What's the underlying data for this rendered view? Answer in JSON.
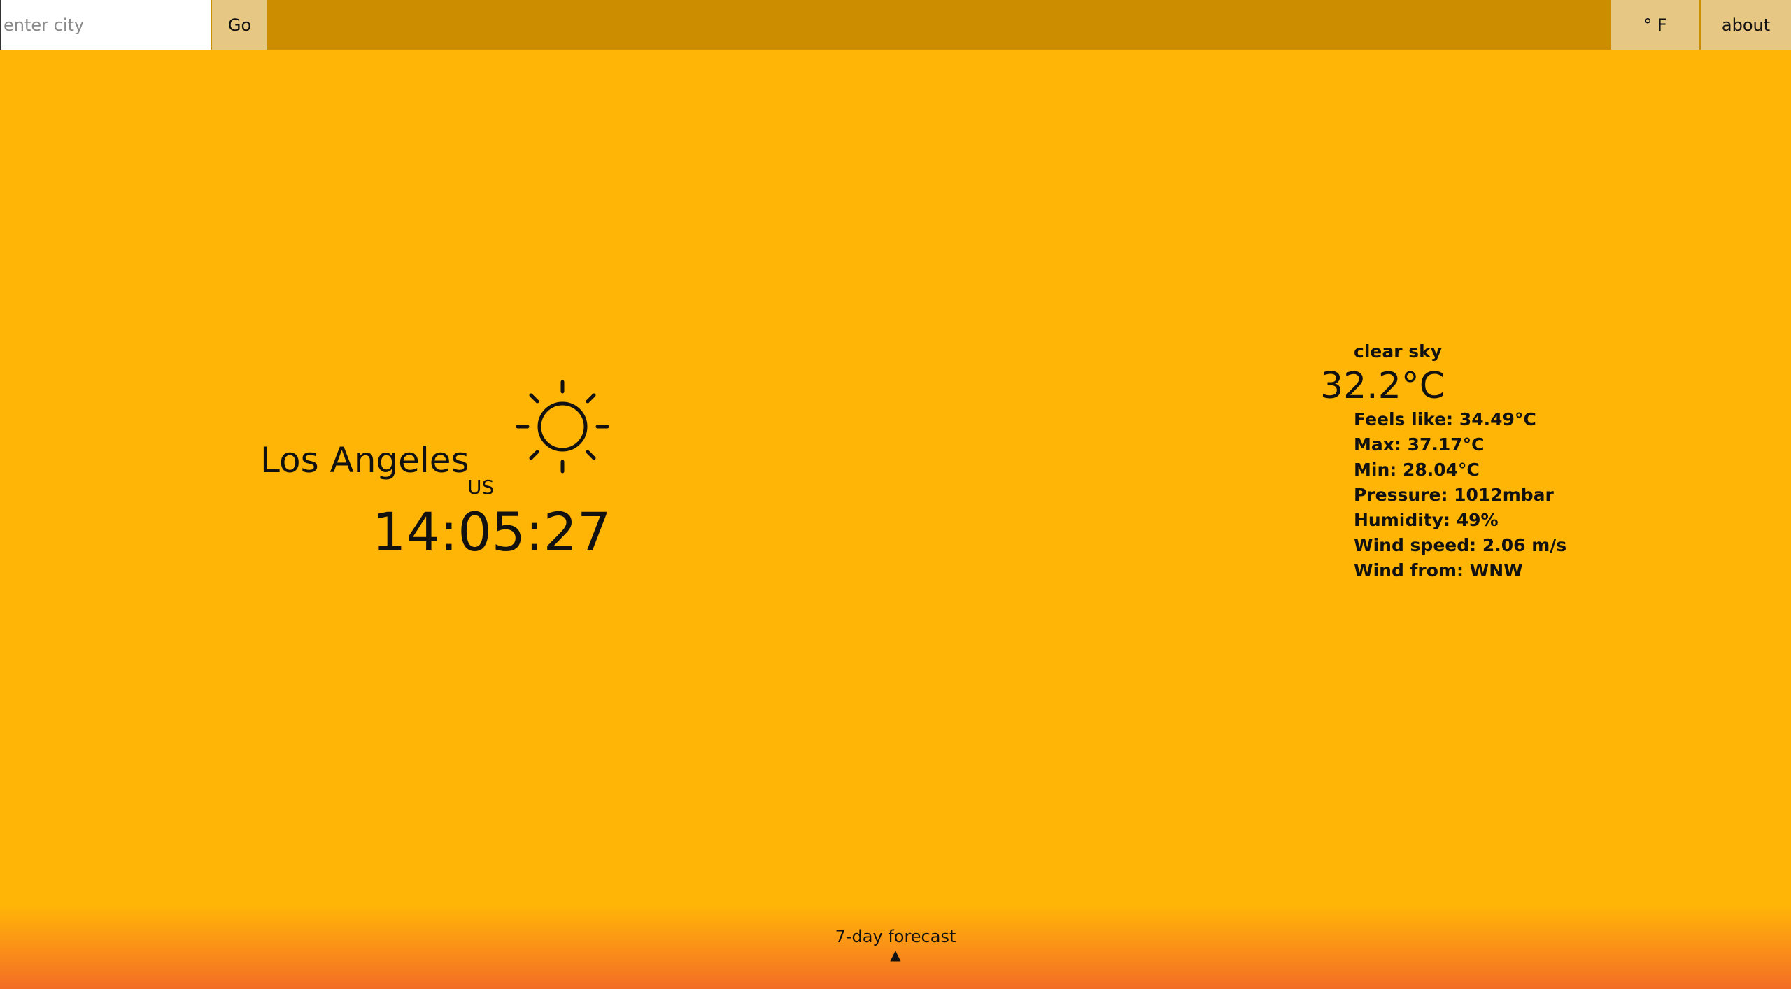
{
  "search": {
    "placeholder": "enter city",
    "value": ""
  },
  "toolbar": {
    "go_label": "Go",
    "unit_label": "° F",
    "about_label": "about"
  },
  "location": {
    "city": "Los Angeles",
    "country": "US",
    "time": "14:05:27",
    "icon": "sun-icon"
  },
  "weather": {
    "description": "clear sky",
    "temperature": "32.2°C",
    "details": [
      "Feels like: 34.49°C",
      "Max: 37.17°C",
      "Min: 28.04°C",
      "Pressure: 1012mbar",
      "Humidity: 49%",
      "Wind speed: 2.06 m/s",
      "Wind from: WNW"
    ]
  },
  "footer": {
    "forecast_label": "7-day forecast",
    "toggle_icon": "▲"
  },
  "colors": {
    "background": "#ffb506",
    "topbar": "#cc8e00",
    "button": "#e6c784",
    "footer_gradient_end": "#f36d25"
  }
}
